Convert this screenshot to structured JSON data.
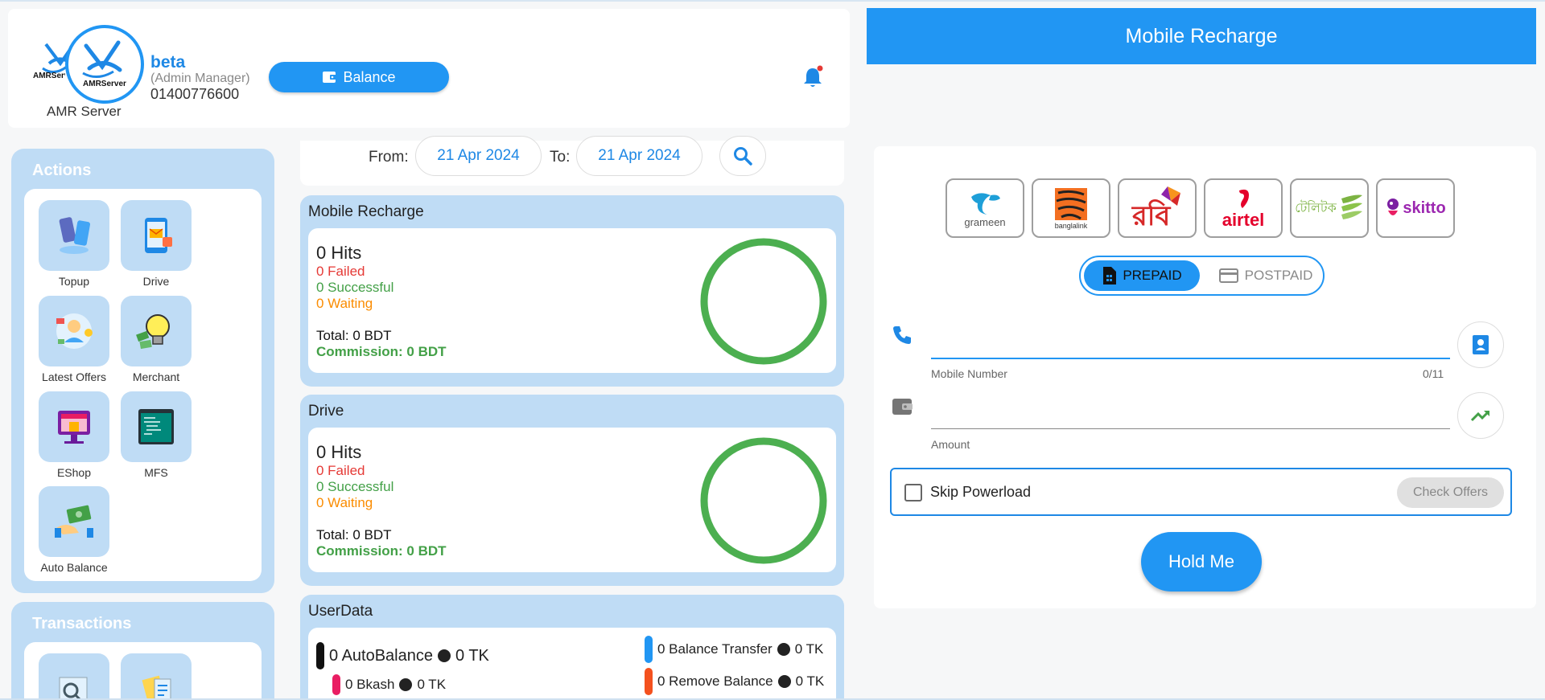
{
  "header": {
    "logo_text": "AMRServer",
    "logo_caption": "AMR Server",
    "user_name": "beta",
    "user_role": "(Admin Manager)",
    "user_phone": "01400776600",
    "balance_label": "Balance",
    "notification_icon": "bell-icon",
    "has_unread_notification": true
  },
  "recharge": {
    "title": "Mobile Recharge",
    "operators": [
      {
        "name": "grameen",
        "color": "#1e9fd8"
      },
      {
        "name": "banglalink",
        "color": "#f36f21"
      },
      {
        "name": "robi",
        "color": "#d62828"
      },
      {
        "name": "airtel",
        "color": "#e4002b"
      },
      {
        "name": "teletalk",
        "color": "#7cb342"
      },
      {
        "name": "skitto",
        "color": "#9c27b0"
      }
    ],
    "operator_labels": {
      "grameen": "grameen",
      "banglalink": "banglalink",
      "robi": "রবি",
      "airtel": "airtel",
      "teletalk": "টেলিটক",
      "skitto": "skitto"
    },
    "type_options": {
      "prepaid": "PREPAID",
      "postpaid": "POSTPAID"
    },
    "selected_type": "PREPAID",
    "mobile": {
      "value": "",
      "label": "Mobile Number",
      "counter": "0/11"
    },
    "amount": {
      "value": "",
      "label": "Amount"
    },
    "skip_powerload": {
      "label": "Skip Powerload",
      "checked": false
    },
    "check_offers_label": "Check Offers",
    "hold_label": "Hold Me"
  },
  "actions_panel": {
    "title": "Actions",
    "items": [
      {
        "label": "Topup",
        "icon": "topup-icon"
      },
      {
        "label": "Drive",
        "icon": "drive-icon"
      },
      {
        "label": "Latest Offers",
        "icon": "latest-offers-icon"
      },
      {
        "label": "Merchant",
        "icon": "merchant-icon"
      },
      {
        "label": "EShop",
        "icon": "eshop-icon"
      },
      {
        "label": "MFS",
        "icon": "mfs-icon"
      },
      {
        "label": "Auto Balance",
        "icon": "auto-balance-icon"
      }
    ]
  },
  "transactions_panel": {
    "title": "Transactions"
  },
  "date_filter": {
    "from_label": "From:",
    "from": "21 Apr 2024",
    "to_label": "To:",
    "to": "21 Apr 2024"
  },
  "stats": [
    {
      "title": "Mobile Recharge",
      "hits": "0 Hits",
      "failed": "0 Failed",
      "successful": "0 Successful",
      "waiting": "0 Waiting",
      "total": "Total: 0 BDT",
      "commission": "Commission: 0 BDT"
    },
    {
      "title": "Drive",
      "hits": "0 Hits",
      "failed": "0 Failed",
      "successful": "0 Successful",
      "waiting": "0 Waiting",
      "total": "Total: 0 BDT",
      "commission": "Commission: 0 BDT"
    }
  ],
  "userdata": {
    "title": "UserData",
    "auto_balance": "0 AutoBalance",
    "auto_balance_tk": "0 TK",
    "bkash": "0 Bkash",
    "bkash_tk": "0 TK",
    "balance_transfer": "0 Balance Transfer",
    "balance_transfer_tk": "0 TK",
    "remove_balance": "0 Remove Balance",
    "remove_balance_tk": "0 TK"
  }
}
